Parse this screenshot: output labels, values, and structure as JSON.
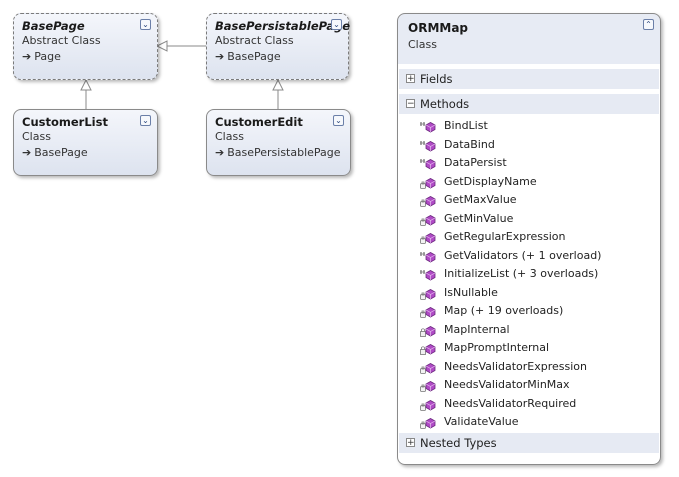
{
  "classes": {
    "base_page": {
      "name": "BasePage",
      "kind": "Abstract Class",
      "base": "Page"
    },
    "base_persistable_page": {
      "name": "BasePersistablePage",
      "kind": "Abstract Class",
      "base": "BasePage"
    },
    "customer_list": {
      "name": "CustomerList",
      "kind": "Class",
      "base": "BasePage"
    },
    "customer_edit": {
      "name": "CustomerEdit",
      "kind": "Class",
      "base": "BasePersistablePage"
    }
  },
  "orm_map": {
    "name": "ORMMap",
    "kind": "Class",
    "sections": {
      "fields": "Fields",
      "methods": "Methods",
      "nested_types": "Nested Types"
    },
    "methods": [
      {
        "name": "BindList",
        "access": "protected"
      },
      {
        "name": "DataBind",
        "access": "protected"
      },
      {
        "name": "DataPersist",
        "access": "protected"
      },
      {
        "name": "GetDisplayName",
        "access": "internal"
      },
      {
        "name": "GetMaxValue",
        "access": "internal"
      },
      {
        "name": "GetMinValue",
        "access": "internal"
      },
      {
        "name": "GetRegularExpression",
        "access": "internal"
      },
      {
        "name": "GetValidators (+ 1 overload)",
        "access": "protected"
      },
      {
        "name": "InitializeList (+ 3 overloads)",
        "access": "protected"
      },
      {
        "name": "IsNullable",
        "access": "internal"
      },
      {
        "name": "Map (+ 19 overloads)",
        "access": "internal"
      },
      {
        "name": "MapInternal",
        "access": "private"
      },
      {
        "name": "MapPromptInternal",
        "access": "private"
      },
      {
        "name": "NeedsValidatorExpression",
        "access": "internal"
      },
      {
        "name": "NeedsValidatorMinMax",
        "access": "internal"
      },
      {
        "name": "NeedsValidatorRequired",
        "access": "internal"
      },
      {
        "name": "ValidateValue",
        "access": "internal"
      }
    ]
  },
  "icons": {
    "collapse": "double-chevron-icon",
    "inherits": "inherits-arrow-icon",
    "method": "method-icon",
    "expand_box": "plus-box-icon",
    "collapse_box": "minus-box-icon"
  },
  "colors": {
    "method_icon": "#b04bc6",
    "border": "#8a8a8a",
    "header_bg": "#e6eaf3"
  }
}
